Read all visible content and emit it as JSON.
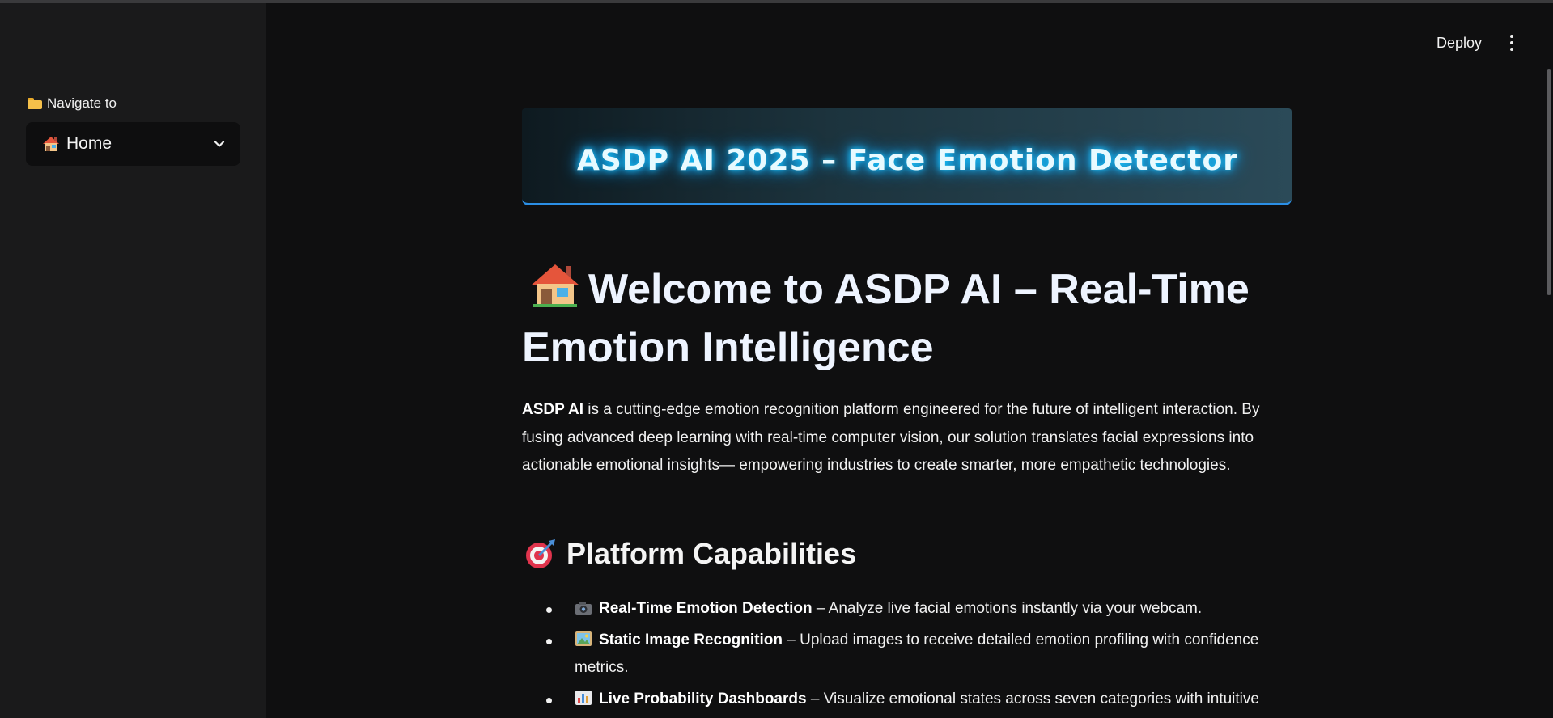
{
  "sidebar": {
    "nav_label": "Navigate to",
    "nav_icon": "folder-icon",
    "selected_page": "Home",
    "selected_icon": "house-icon"
  },
  "header": {
    "deploy_label": "Deploy",
    "menu_icon": "kebab-menu-icon"
  },
  "banner": {
    "title": "ASDP AI 2025 – Face Emotion Detector",
    "accent_color": "#2b8fe6",
    "glow_color": "#18c8ff"
  },
  "main": {
    "title": "Welcome to ASDP AI – Real-Time Emotion Intelligence",
    "intro_bold": "ASDP AI",
    "intro_text": " is a cutting-edge emotion recognition platform engineered for the future of intelligent interaction. By fusing advanced deep learning with real-time computer vision, our solution translates facial expressions into actionable emotional insights— empowering industries to create smarter, more empathetic technologies.",
    "capabilities_heading": "Platform Capabilities",
    "capabilities": [
      {
        "icon": "camera-icon",
        "title": "Real-Time Emotion Detection",
        "desc": " – Analyze live facial emotions instantly via your webcam."
      },
      {
        "icon": "picture-icon",
        "title": "Static Image Recognition",
        "desc": " – Upload images to receive detailed emotion profiling with confidence metrics."
      },
      {
        "icon": "bar-chart-icon",
        "title": "Live Probability Dashboards",
        "desc": " – Visualize emotional states across seven categories with intuitive"
      }
    ]
  }
}
